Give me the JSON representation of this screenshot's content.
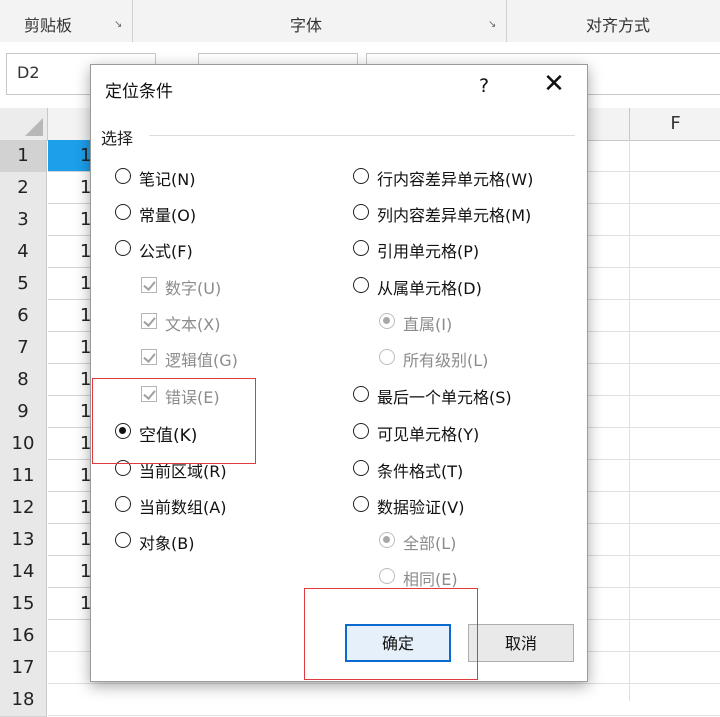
{
  "ribbon": {
    "groups": [
      {
        "label": "剪贴板"
      },
      {
        "label": "字体"
      },
      {
        "label": "对齐方式"
      }
    ]
  },
  "namebox": {
    "value": "D2"
  },
  "columns": {
    "f_label": "F"
  },
  "rows": [
    "1",
    "2",
    "3",
    "4",
    "5",
    "6",
    "7",
    "8",
    "9",
    "10",
    "11",
    "12",
    "13",
    "14",
    "15",
    "16",
    "17",
    "18"
  ],
  "cell_value": "1",
  "dialog": {
    "title": "定位条件",
    "help": "?",
    "close": "✕",
    "section": "选择",
    "left_options": [
      {
        "label": "笔记(N)"
      },
      {
        "label": "常量(O)"
      },
      {
        "label": "公式(F)"
      }
    ],
    "formula_checks": [
      {
        "label": "数字(U)",
        "checked": true
      },
      {
        "label": "文本(X)",
        "checked": true
      },
      {
        "label": "逻辑值(G)",
        "checked": true
      },
      {
        "label": "错误(E)",
        "checked": true
      }
    ],
    "left_options2": [
      {
        "label": "空值(K)",
        "selected": true
      },
      {
        "label": "当前区域(R)"
      },
      {
        "label": "当前数组(A)"
      },
      {
        "label": "对象(B)"
      }
    ],
    "right_options": [
      {
        "label": "行内容差异单元格(W)"
      },
      {
        "label": "列内容差异单元格(M)"
      },
      {
        "label": "引用单元格(P)"
      },
      {
        "label": "从属单元格(D)"
      }
    ],
    "dependents_sub": [
      {
        "label": "直属(I)",
        "selected": true
      },
      {
        "label": "所有级别(L)"
      }
    ],
    "right_options2": [
      {
        "label": "最后一个单元格(S)"
      },
      {
        "label": "可见单元格(Y)"
      },
      {
        "label": "条件格式(T)"
      },
      {
        "label": "数据验证(V)"
      }
    ],
    "validation_sub": [
      {
        "label": "全部(L)",
        "selected": true
      },
      {
        "label": "相同(E)"
      }
    ],
    "ok_label": "确定",
    "cancel_label": "取消"
  },
  "colors": {
    "accent": "#1e9fea",
    "highlight": "#e0393e",
    "default_button": "#0a6ad0"
  }
}
